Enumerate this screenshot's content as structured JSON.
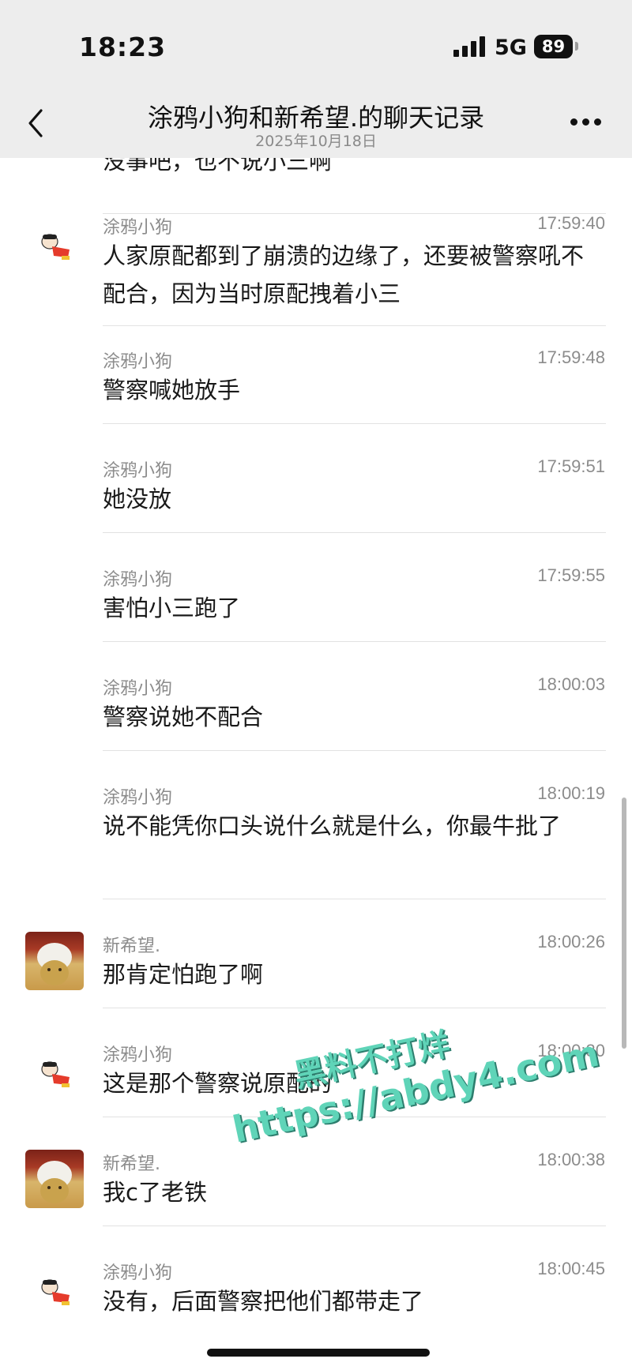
{
  "status_bar": {
    "time": "18:23",
    "network": "5G",
    "battery": "89"
  },
  "nav": {
    "title": "涂鸦小狗和新希望.的聊天记录",
    "date": "2025年10月18日"
  },
  "messages": [
    {
      "name": "",
      "time": "",
      "text": "没事吧，也不说小三啊"
    },
    {
      "name": "涂鸦小狗",
      "time": "17:59:40",
      "text": "人家原配都到了崩溃的边缘了，还要被警察吼不配合，因为当时原配拽着小三"
    },
    {
      "name": "涂鸦小狗",
      "time": "17:59:48",
      "text": "警察喊她放手"
    },
    {
      "name": "涂鸦小狗",
      "time": "17:59:51",
      "text": "她没放"
    },
    {
      "name": "涂鸦小狗",
      "time": "17:59:55",
      "text": "害怕小三跑了"
    },
    {
      "name": "涂鸦小狗",
      "time": "18:00:03",
      "text": "警察说她不配合"
    },
    {
      "name": "涂鸦小狗",
      "time": "18:00:19",
      "text": "说不能凭你口头说什么就是什么，你最牛批了"
    },
    {
      "name": "新希望.",
      "time": "18:00:26",
      "text": "那肯定怕跑了啊"
    },
    {
      "name": "涂鸦小狗",
      "time": "18:00:30",
      "text": "这是那个警察说原配的"
    },
    {
      "name": "新希望.",
      "time": "18:00:38",
      "text": "我c了老铁"
    },
    {
      "name": "涂鸦小狗",
      "time": "18:00:45",
      "text": "没有，后面警察把他们都带走了"
    }
  ],
  "watermark": {
    "line1": "黑料不打烊",
    "line2": "https://abdy4.com"
  }
}
